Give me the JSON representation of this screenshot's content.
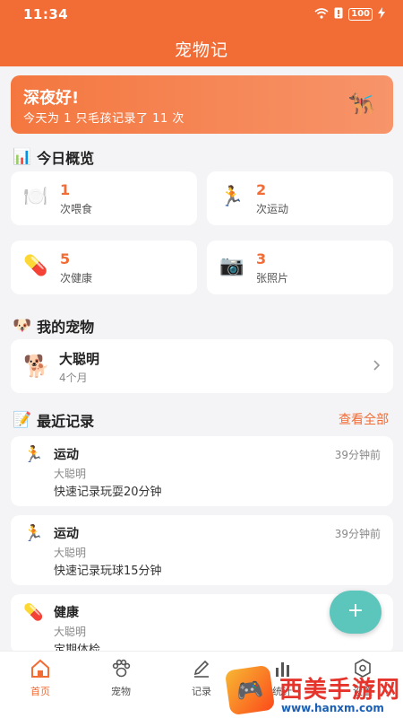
{
  "status": {
    "time": "11:34",
    "battery": "100"
  },
  "app_title": "宠物记",
  "greeting": {
    "title": "深夜好!",
    "subtitle": "今天为 1 只毛孩记录了 11 次",
    "emoji": "🐕‍🦺"
  },
  "overview": {
    "title": "今日概览",
    "stats": [
      {
        "value": "1",
        "label": "次喂食",
        "icon": "🍽️"
      },
      {
        "value": "2",
        "label": "次运动",
        "icon": "🏃"
      },
      {
        "value": "5",
        "label": "次健康",
        "icon": "💊"
      },
      {
        "value": "3",
        "label": "张照片",
        "icon": "📷"
      }
    ]
  },
  "my_pets": {
    "title": "我的宠物",
    "pets": [
      {
        "name": "大聪明",
        "age": "4个月",
        "icon": "🐕"
      }
    ]
  },
  "recent": {
    "title": "最近记录",
    "see_all": "查看全部",
    "records": [
      {
        "type": "运动",
        "time": "39分钟前",
        "pet": "大聪明",
        "note": "快速记录玩耍20分钟",
        "icon": "🏃"
      },
      {
        "type": "运动",
        "time": "39分钟前",
        "pet": "大聪明",
        "note": "快速记录玩球15分钟",
        "icon": "🏃"
      },
      {
        "type": "健康",
        "time": "",
        "pet": "大聪明",
        "note": "定期体检",
        "icon": "💊"
      }
    ]
  },
  "fab_label": "+",
  "tabs": [
    {
      "label": "首页",
      "icon": "home-icon"
    },
    {
      "label": "宠物",
      "icon": "paw-icon"
    },
    {
      "label": "记录",
      "icon": "pencil-icon"
    },
    {
      "label": "统计",
      "icon": "chart-icon"
    },
    {
      "label": "设置",
      "icon": "gear-icon"
    }
  ],
  "watermark": {
    "title": "西美手游网",
    "url": "www.hanxm.com"
  },
  "colors": {
    "accent": "#f26c36",
    "fab": "#5cc6bd"
  }
}
